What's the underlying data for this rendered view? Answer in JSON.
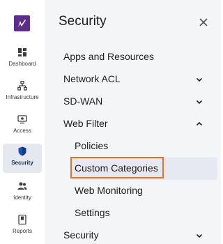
{
  "rail": {
    "items": [
      {
        "label": "Dashboard",
        "icon": "dashboard-icon"
      },
      {
        "label": "Infrastructure",
        "icon": "infrastructure-icon"
      },
      {
        "label": "Access",
        "icon": "access-icon"
      },
      {
        "label": "Security",
        "icon": "shield-icon",
        "active": true
      },
      {
        "label": "Identity",
        "icon": "users-icon"
      },
      {
        "label": "Reports",
        "icon": "report-icon"
      }
    ]
  },
  "panel": {
    "title": "Security",
    "items": [
      {
        "label": "Apps and Resources",
        "expandable": false
      },
      {
        "label": "Network ACL",
        "expandable": true,
        "expanded": false
      },
      {
        "label": "SD-WAN",
        "expandable": true,
        "expanded": false
      },
      {
        "label": "Web Filter",
        "expandable": true,
        "expanded": true,
        "children": [
          "Policies",
          "Custom Categories",
          "Web Monitoring",
          "Settings"
        ]
      },
      {
        "label": "Security",
        "expandable": true,
        "expanded": false
      }
    ],
    "selected_child": "Custom Categories"
  },
  "colors": {
    "brand": "#5b2e8c",
    "active_rail": "#1b2a52",
    "highlight": "#e8731d",
    "panel_bg": "#f4f5f7"
  }
}
